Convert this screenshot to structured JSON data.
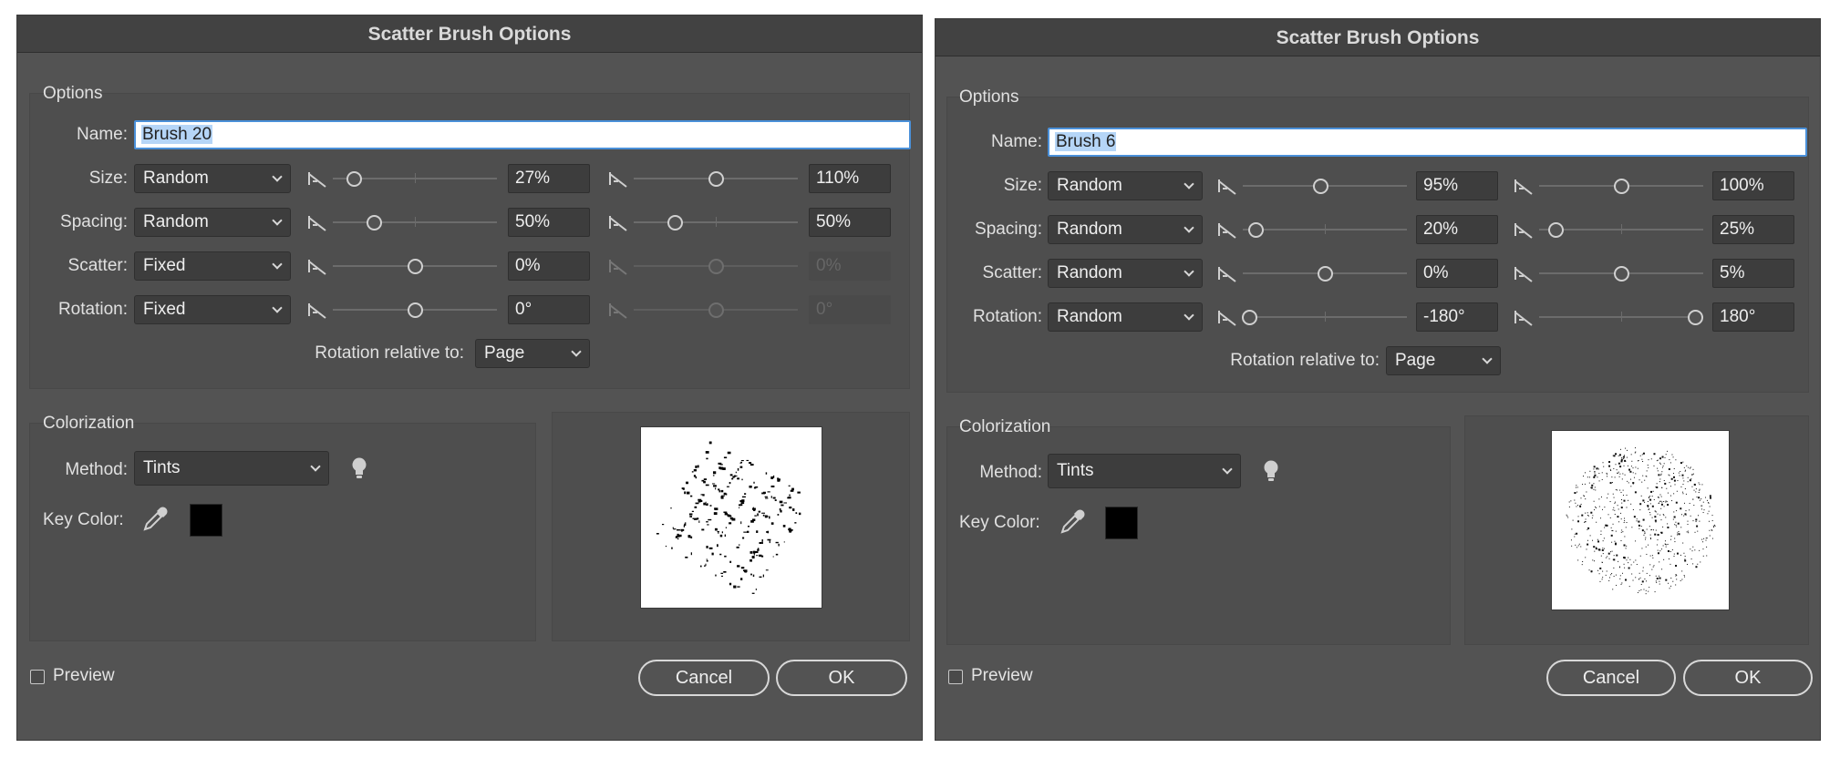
{
  "dialogs": [
    {
      "title": "Scatter Brush Options",
      "options_legend": "Options",
      "name_label": "Name:",
      "name_value": "Brush 20",
      "rows": [
        {
          "label": "Size:",
          "method": "Random",
          "min_value": "27%",
          "max_value": "110%",
          "min_knob": 0.13,
          "max_knob": 0.5,
          "max_disabled": false
        },
        {
          "label": "Spacing:",
          "method": "Random",
          "min_value": "50%",
          "max_value": "50%",
          "min_knob": 0.25,
          "max_knob": 0.25,
          "max_disabled": false
        },
        {
          "label": "Scatter:",
          "method": "Fixed",
          "min_value": "0%",
          "max_value": "0%",
          "min_knob": 0.5,
          "max_knob": 0.5,
          "max_disabled": true
        },
        {
          "label": "Rotation:",
          "method": "Fixed",
          "min_value": "0°",
          "max_value": "0°",
          "min_knob": 0.5,
          "max_knob": 0.5,
          "max_disabled": true
        }
      ],
      "rotation_relative_label": "Rotation relative to:",
      "rotation_relative_value": "Page",
      "colorization_legend": "Colorization",
      "method_label": "Method:",
      "method_value": "Tints",
      "key_color_label": "Key Color:",
      "key_color": "#000000",
      "preview_label": "Preview",
      "cancel_label": "Cancel",
      "ok_label": "OK",
      "preview_style": "grid"
    },
    {
      "title": "Scatter Brush Options",
      "options_legend": "Options",
      "name_label": "Name:",
      "name_value": "Brush 6",
      "rows": [
        {
          "label": "Size:",
          "method": "Random",
          "min_value": "95%",
          "max_value": "100%",
          "min_knob": 0.47,
          "max_knob": 0.5,
          "max_disabled": false
        },
        {
          "label": "Spacing:",
          "method": "Random",
          "min_value": "20%",
          "max_value": "25%",
          "min_knob": 0.08,
          "max_knob": 0.1,
          "max_disabled": false
        },
        {
          "label": "Scatter:",
          "method": "Random",
          "min_value": "0%",
          "max_value": "5%",
          "min_knob": 0.5,
          "max_knob": 0.5,
          "max_disabled": false
        },
        {
          "label": "Rotation:",
          "method": "Random",
          "min_value": "-180°",
          "max_value": "180°",
          "min_knob": 0.04,
          "max_knob": 0.95,
          "max_disabled": false
        }
      ],
      "rotation_relative_label": "Rotation relative to:",
      "rotation_relative_value": "Page",
      "colorization_legend": "Colorization",
      "method_label": "Method:",
      "method_value": "Tints",
      "key_color_label": "Key Color:",
      "key_color": "#000000",
      "preview_label": "Preview",
      "cancel_label": "Cancel",
      "ok_label": "OK",
      "preview_style": "circle"
    }
  ]
}
